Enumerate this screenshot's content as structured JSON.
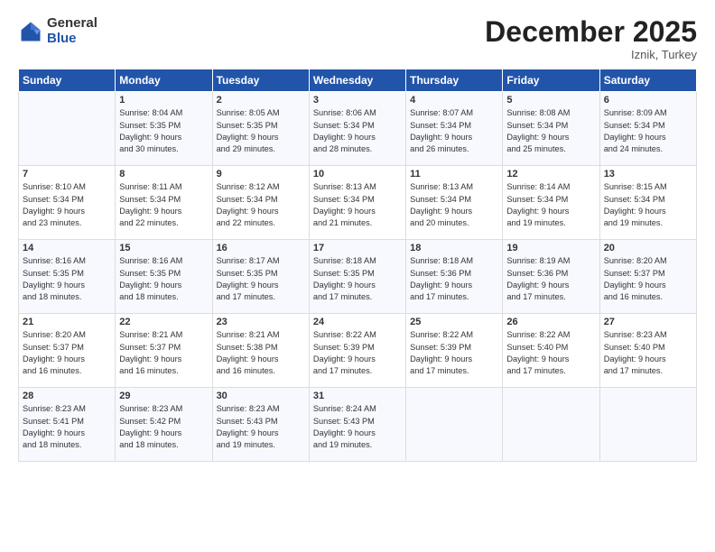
{
  "logo": {
    "general": "General",
    "blue": "Blue"
  },
  "header": {
    "month": "December 2025",
    "location": "Iznik, Turkey"
  },
  "days_of_week": [
    "Sunday",
    "Monday",
    "Tuesday",
    "Wednesday",
    "Thursday",
    "Friday",
    "Saturday"
  ],
  "weeks": [
    [
      {
        "num": "",
        "info": ""
      },
      {
        "num": "1",
        "info": "Sunrise: 8:04 AM\nSunset: 5:35 PM\nDaylight: 9 hours\nand 30 minutes."
      },
      {
        "num": "2",
        "info": "Sunrise: 8:05 AM\nSunset: 5:35 PM\nDaylight: 9 hours\nand 29 minutes."
      },
      {
        "num": "3",
        "info": "Sunrise: 8:06 AM\nSunset: 5:34 PM\nDaylight: 9 hours\nand 28 minutes."
      },
      {
        "num": "4",
        "info": "Sunrise: 8:07 AM\nSunset: 5:34 PM\nDaylight: 9 hours\nand 26 minutes."
      },
      {
        "num": "5",
        "info": "Sunrise: 8:08 AM\nSunset: 5:34 PM\nDaylight: 9 hours\nand 25 minutes."
      },
      {
        "num": "6",
        "info": "Sunrise: 8:09 AM\nSunset: 5:34 PM\nDaylight: 9 hours\nand 24 minutes."
      }
    ],
    [
      {
        "num": "7",
        "info": "Sunrise: 8:10 AM\nSunset: 5:34 PM\nDaylight: 9 hours\nand 23 minutes."
      },
      {
        "num": "8",
        "info": "Sunrise: 8:11 AM\nSunset: 5:34 PM\nDaylight: 9 hours\nand 22 minutes."
      },
      {
        "num": "9",
        "info": "Sunrise: 8:12 AM\nSunset: 5:34 PM\nDaylight: 9 hours\nand 22 minutes."
      },
      {
        "num": "10",
        "info": "Sunrise: 8:13 AM\nSunset: 5:34 PM\nDaylight: 9 hours\nand 21 minutes."
      },
      {
        "num": "11",
        "info": "Sunrise: 8:13 AM\nSunset: 5:34 PM\nDaylight: 9 hours\nand 20 minutes."
      },
      {
        "num": "12",
        "info": "Sunrise: 8:14 AM\nSunset: 5:34 PM\nDaylight: 9 hours\nand 19 minutes."
      },
      {
        "num": "13",
        "info": "Sunrise: 8:15 AM\nSunset: 5:34 PM\nDaylight: 9 hours\nand 19 minutes."
      }
    ],
    [
      {
        "num": "14",
        "info": "Sunrise: 8:16 AM\nSunset: 5:35 PM\nDaylight: 9 hours\nand 18 minutes."
      },
      {
        "num": "15",
        "info": "Sunrise: 8:16 AM\nSunset: 5:35 PM\nDaylight: 9 hours\nand 18 minutes."
      },
      {
        "num": "16",
        "info": "Sunrise: 8:17 AM\nSunset: 5:35 PM\nDaylight: 9 hours\nand 17 minutes."
      },
      {
        "num": "17",
        "info": "Sunrise: 8:18 AM\nSunset: 5:35 PM\nDaylight: 9 hours\nand 17 minutes."
      },
      {
        "num": "18",
        "info": "Sunrise: 8:18 AM\nSunset: 5:36 PM\nDaylight: 9 hours\nand 17 minutes."
      },
      {
        "num": "19",
        "info": "Sunrise: 8:19 AM\nSunset: 5:36 PM\nDaylight: 9 hours\nand 17 minutes."
      },
      {
        "num": "20",
        "info": "Sunrise: 8:20 AM\nSunset: 5:37 PM\nDaylight: 9 hours\nand 16 minutes."
      }
    ],
    [
      {
        "num": "21",
        "info": "Sunrise: 8:20 AM\nSunset: 5:37 PM\nDaylight: 9 hours\nand 16 minutes."
      },
      {
        "num": "22",
        "info": "Sunrise: 8:21 AM\nSunset: 5:37 PM\nDaylight: 9 hours\nand 16 minutes."
      },
      {
        "num": "23",
        "info": "Sunrise: 8:21 AM\nSunset: 5:38 PM\nDaylight: 9 hours\nand 16 minutes."
      },
      {
        "num": "24",
        "info": "Sunrise: 8:22 AM\nSunset: 5:39 PM\nDaylight: 9 hours\nand 17 minutes."
      },
      {
        "num": "25",
        "info": "Sunrise: 8:22 AM\nSunset: 5:39 PM\nDaylight: 9 hours\nand 17 minutes."
      },
      {
        "num": "26",
        "info": "Sunrise: 8:22 AM\nSunset: 5:40 PM\nDaylight: 9 hours\nand 17 minutes."
      },
      {
        "num": "27",
        "info": "Sunrise: 8:23 AM\nSunset: 5:40 PM\nDaylight: 9 hours\nand 17 minutes."
      }
    ],
    [
      {
        "num": "28",
        "info": "Sunrise: 8:23 AM\nSunset: 5:41 PM\nDaylight: 9 hours\nand 18 minutes."
      },
      {
        "num": "29",
        "info": "Sunrise: 8:23 AM\nSunset: 5:42 PM\nDaylight: 9 hours\nand 18 minutes."
      },
      {
        "num": "30",
        "info": "Sunrise: 8:23 AM\nSunset: 5:43 PM\nDaylight: 9 hours\nand 19 minutes."
      },
      {
        "num": "31",
        "info": "Sunrise: 8:24 AM\nSunset: 5:43 PM\nDaylight: 9 hours\nand 19 minutes."
      },
      {
        "num": "",
        "info": ""
      },
      {
        "num": "",
        "info": ""
      },
      {
        "num": "",
        "info": ""
      }
    ]
  ]
}
